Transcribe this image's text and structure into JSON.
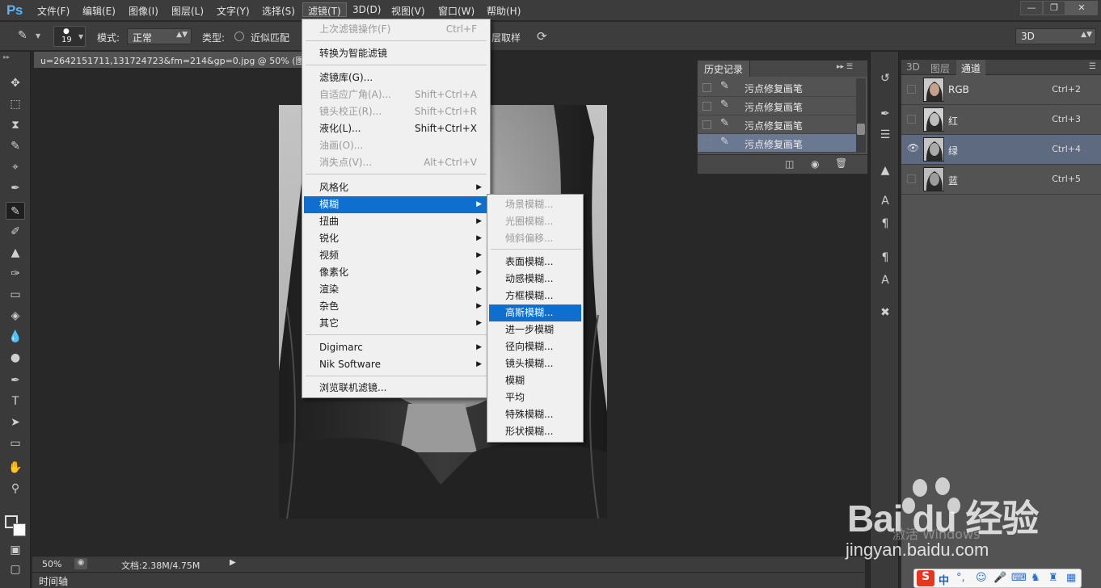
{
  "app": {
    "logo": "Ps"
  },
  "menubar": {
    "items": [
      "文件(F)",
      "编辑(E)",
      "图像(I)",
      "图层(L)",
      "文字(Y)",
      "选择(S)",
      "滤镜(T)",
      "3D(D)",
      "视图(V)",
      "窗口(W)",
      "帮助(H)"
    ],
    "active_index": 6,
    "window_buttons": [
      "—",
      "❐",
      "✕"
    ]
  },
  "options": {
    "brush_size": "19",
    "mode_label": "模式:",
    "mode_value": "正常",
    "type_label": "类型:",
    "type_option": "近似匹配",
    "sample_all_layers": "对所有图层取样",
    "workspace": "3D"
  },
  "document": {
    "tab_title": "u=2642151711,131724723&fm=214&gp=0.jpg @ 50% (图层",
    "zoom": "50%",
    "doc_info": "文档:2.38M/4.75M",
    "timeline_label": "时间轴"
  },
  "filter_menu": {
    "items": [
      {
        "label": "上次滤镜操作(F)",
        "shortcut": "Ctrl+F",
        "disabled": true
      },
      {
        "label": "转换为智能滤镜"
      },
      {
        "label": "滤镜库(G)..."
      },
      {
        "label": "自适应广角(A)...",
        "shortcut": "Shift+Ctrl+A",
        "disabled": true
      },
      {
        "label": "镜头校正(R)...",
        "shortcut": "Shift+Ctrl+R",
        "disabled": true
      },
      {
        "label": "液化(L)...",
        "shortcut": "Shift+Ctrl+X"
      },
      {
        "label": "油画(O)...",
        "disabled": true
      },
      {
        "label": "消失点(V)...",
        "shortcut": "Alt+Ctrl+V",
        "disabled": true
      },
      {
        "label": "风格化",
        "submenu": true
      },
      {
        "label": "模糊",
        "submenu": true,
        "highlighted": true
      },
      {
        "label": "扭曲",
        "submenu": true
      },
      {
        "label": "锐化",
        "submenu": true
      },
      {
        "label": "视频",
        "submenu": true
      },
      {
        "label": "像素化",
        "submenu": true
      },
      {
        "label": "渲染",
        "submenu": true
      },
      {
        "label": "杂色",
        "submenu": true
      },
      {
        "label": "其它",
        "submenu": true
      },
      {
        "label": "Digimarc",
        "submenu": true
      },
      {
        "label": "Nik Software",
        "submenu": true
      },
      {
        "label": "浏览联机滤镜..."
      }
    ]
  },
  "blur_submenu": {
    "items": [
      {
        "label": "场景模糊...",
        "disabled": true
      },
      {
        "label": "光圈模糊...",
        "disabled": true
      },
      {
        "label": "倾斜偏移...",
        "disabled": true
      },
      {
        "label": "表面模糊..."
      },
      {
        "label": "动感模糊..."
      },
      {
        "label": "方框模糊..."
      },
      {
        "label": "高斯模糊...",
        "highlighted": true
      },
      {
        "label": "进一步模糊"
      },
      {
        "label": "径向模糊..."
      },
      {
        "label": "镜头模糊..."
      },
      {
        "label": "模糊"
      },
      {
        "label": "平均"
      },
      {
        "label": "特殊模糊..."
      },
      {
        "label": "形状模糊..."
      }
    ]
  },
  "history_panel": {
    "title": "历史记录",
    "rows": [
      "污点修复画笔",
      "污点修复画笔",
      "污点修复画笔",
      "污点修复画笔"
    ],
    "selected_index": 3
  },
  "channels_panel": {
    "tabs": [
      "3D",
      "图层",
      "通道"
    ],
    "active_tab": 2,
    "rows": [
      {
        "name": "RGB",
        "shortcut": "Ctrl+2"
      },
      {
        "name": "红",
        "shortcut": "Ctrl+3"
      },
      {
        "name": "绿",
        "shortcut": "Ctrl+4",
        "selected": true
      },
      {
        "name": "蓝",
        "shortcut": "Ctrl+5"
      }
    ]
  },
  "watermark": {
    "logo": "Bai du 经验",
    "url": "jingyan.baidu.com",
    "activate": "激活 Windows"
  },
  "ime": {
    "label": "中"
  }
}
